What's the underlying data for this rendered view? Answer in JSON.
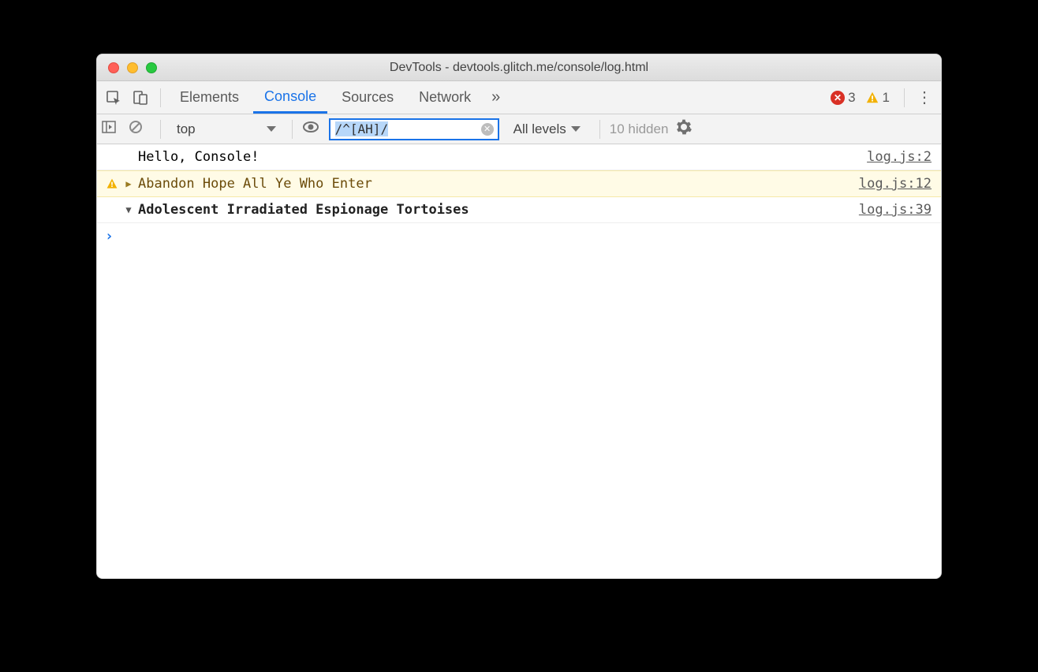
{
  "window": {
    "title": "DevTools - devtools.glitch.me/console/log.html"
  },
  "tabs": {
    "items": [
      "Elements",
      "Console",
      "Sources",
      "Network"
    ],
    "overflow_icon": "»",
    "active_index": 1
  },
  "counts": {
    "errors": "3",
    "warnings": "1"
  },
  "console_toolbar": {
    "context": "top",
    "filter_value": "/^[AH]/",
    "levels_label": "All levels",
    "hidden_label": "10 hidden"
  },
  "messages": [
    {
      "type": "log",
      "disclosure": "",
      "text": "Hello, Console!",
      "source": "log.js:2"
    },
    {
      "type": "warn",
      "disclosure": "▶",
      "text": "Abandon Hope All Ye Who Enter",
      "source": "log.js:12"
    },
    {
      "type": "group",
      "disclosure": "▼",
      "text": "Adolescent Irradiated Espionage Tortoises",
      "source": "log.js:39"
    }
  ],
  "prompt": "›"
}
